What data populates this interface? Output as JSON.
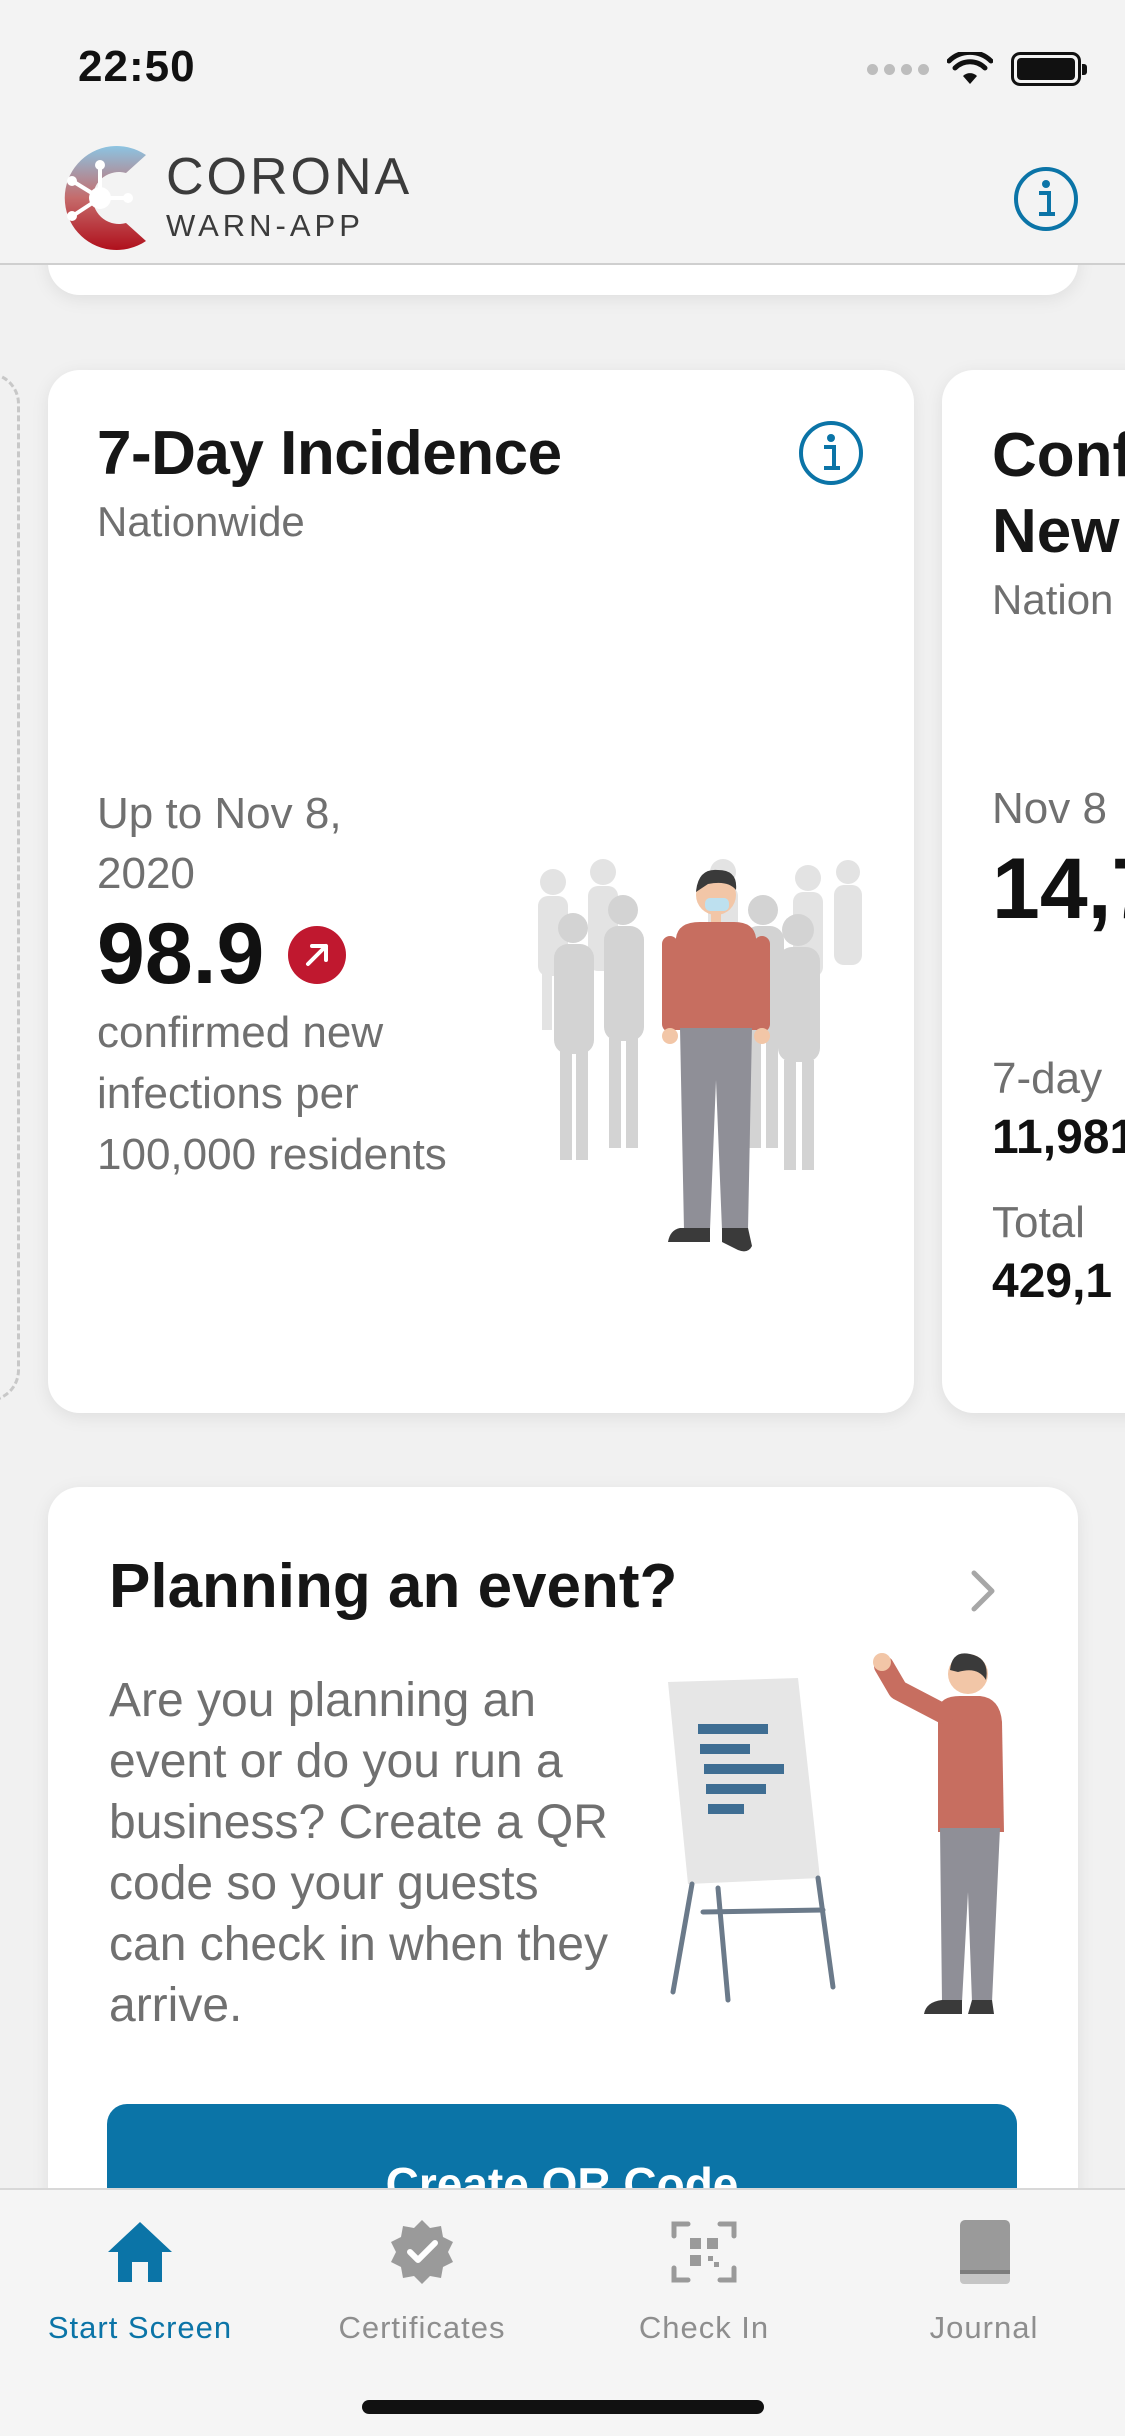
{
  "status_bar": {
    "time": "22:50"
  },
  "header": {
    "brand_title": "CORONA",
    "brand_subtitle": "WARN-APP",
    "info_icon": "info-icon"
  },
  "incidence_card": {
    "title": "7-Day Incidence",
    "subtitle": "Nationwide",
    "date": "Up to Nov 8, 2020",
    "value": "98.9",
    "trend": "increasing",
    "description": "confirmed new infections per 100,000 residents"
  },
  "cases_card": {
    "title_line1": "Conf",
    "title_line2": "New",
    "subtitle": "Nation",
    "date": "Nov 8",
    "value": "14,7",
    "seven_day_label": "7-day",
    "seven_day_value": "11,981",
    "total_label": "Total",
    "total_value": "429,1"
  },
  "event_card": {
    "title": "Planning an event?",
    "description": "Are you planning an event or do you run a business? Create a QR code so your guests can check in when they arrive.",
    "button_label": "Create QR Code"
  },
  "tab_bar": {
    "tabs": [
      {
        "label": "Start Screen",
        "icon": "home-icon",
        "active": true
      },
      {
        "label": "Certificates",
        "icon": "certificate-icon",
        "active": false
      },
      {
        "label": "Check In",
        "icon": "qr-scan-icon",
        "active": false
      },
      {
        "label": "Journal",
        "icon": "journal-icon",
        "active": false
      }
    ]
  },
  "colors": {
    "accent": "#0b74a7",
    "trend_red": "#c0182f",
    "text_primary": "#161616",
    "text_secondary": "#707070",
    "background": "#f1f1f1"
  }
}
